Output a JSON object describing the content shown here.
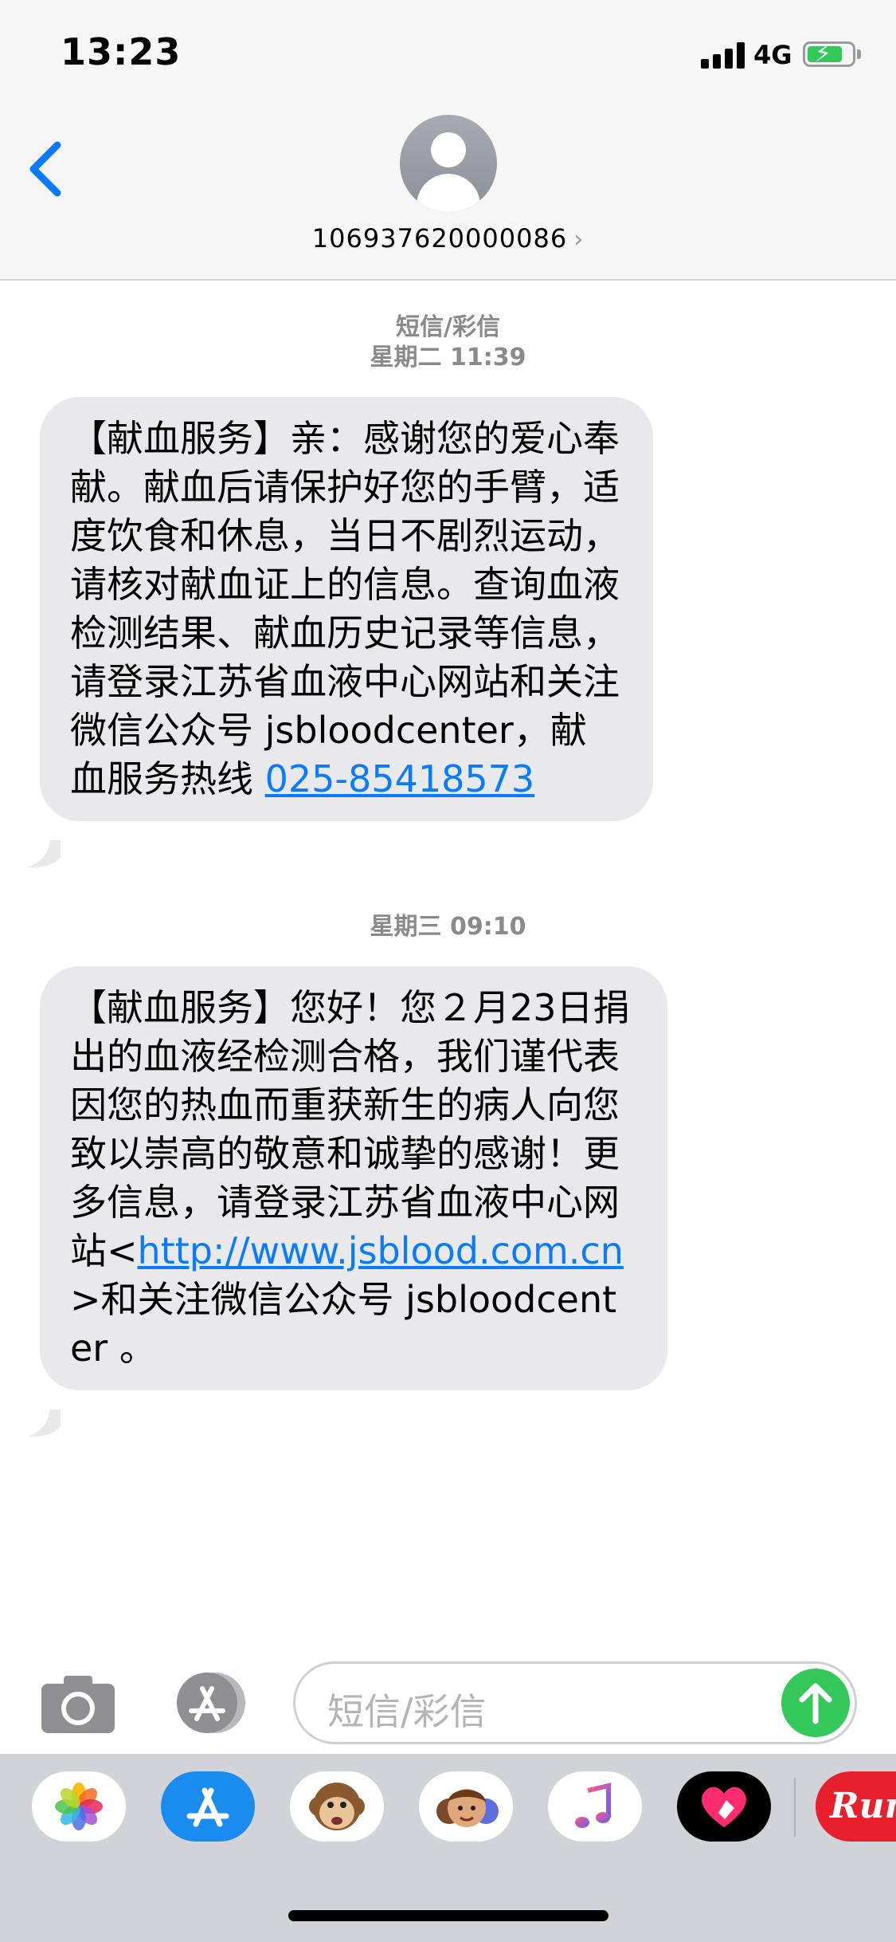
{
  "status_bar": {
    "time": "13:23",
    "network": "4G",
    "battery_level": 0.8,
    "battery_color": "#34c759"
  },
  "header": {
    "contact_number": "106937620000086",
    "chevron": "›",
    "back_icon": "chevron-left-icon"
  },
  "messages": {
    "group1": {
      "label": "短信/彩信",
      "time": "星期二 11:39",
      "text": "【献血服务】亲：感谢您的爱心奉献。献血后请保护好您的手臂，适度饮食和休息，当日不剧烈运动，请核对献血证上的信息。查询血液检测结果、献血历史记录等信息，请登录江苏省血液中心网站和关注微信公众号 jsbloodcenter，献血服务热线 ",
      "phone_link": "025-85418573"
    },
    "group2": {
      "time": "星期三 09:10",
      "text_before": "【献血服务】您好！您２月23日捐出的血液经检测合格，我们谨代表因您的热血而重获新生的病人向您致以崇高的敬意和诚挚的感谢！更多信息，请登录江苏省血液中心网站<",
      "url_link": "http://www.jsblood.com.cn",
      "text_after": ">和关注微信公众号 jsbloodcenter 。"
    }
  },
  "input": {
    "placeholder": "短信/彩信"
  },
  "colors": {
    "link": "#0a7aff",
    "bubble": "#e9e9eb",
    "send": "#34c759"
  },
  "app_drawer": {
    "apps": [
      "photos-icon",
      "app-store-icon",
      "animoji-icon",
      "memoji-icon",
      "music-icon",
      "digital-touch-icon",
      "partial-app-icon"
    ],
    "partial_app_text": "Run"
  }
}
